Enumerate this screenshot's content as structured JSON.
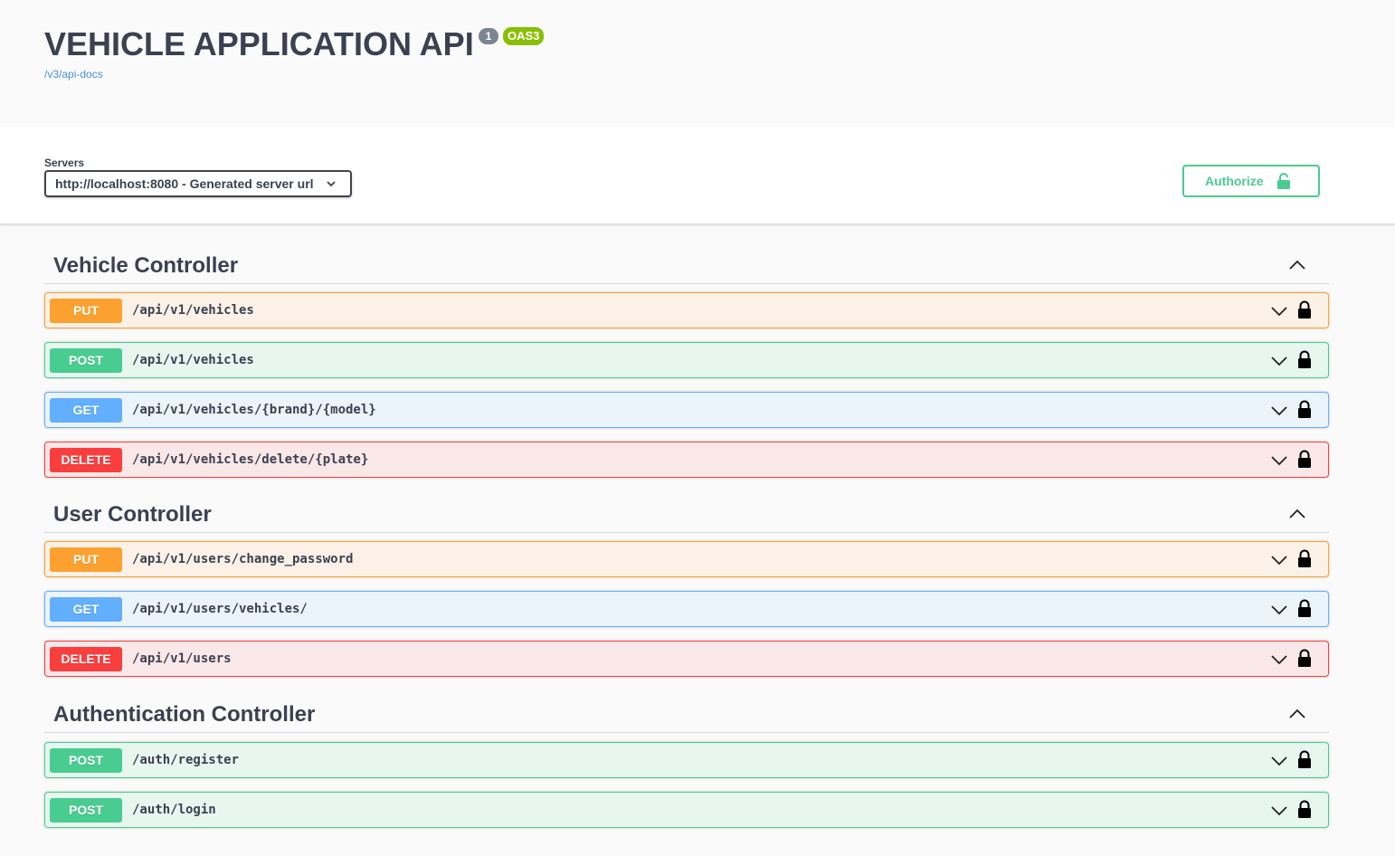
{
  "info": {
    "title": "VEHICLE APPLICATION API",
    "version": "1",
    "oas_badge": "OAS3",
    "spec_link": "/v3/api-docs"
  },
  "servers": {
    "label": "Servers",
    "selected": "http://localhost:8080 - Generated server url"
  },
  "authorize": {
    "label": "Authorize"
  },
  "colors": {
    "put": "#fca130",
    "post": "#49cc90",
    "get": "#61affe",
    "delete": "#f93e3e"
  },
  "tags": [
    {
      "name": "Vehicle Controller",
      "operations": [
        {
          "method": "PUT",
          "path": "/api/v1/vehicles"
        },
        {
          "method": "POST",
          "path": "/api/v1/vehicles"
        },
        {
          "method": "GET",
          "path": "/api/v1/vehicles/{brand}/{model}"
        },
        {
          "method": "DELETE",
          "path": "/api/v1/vehicles/delete/{plate}"
        }
      ]
    },
    {
      "name": "User Controller",
      "operations": [
        {
          "method": "PUT",
          "path": "/api/v1/users/change_password"
        },
        {
          "method": "GET",
          "path": "/api/v1/users/vehicles/"
        },
        {
          "method": "DELETE",
          "path": "/api/v1/users"
        }
      ]
    },
    {
      "name": "Authentication Controller",
      "operations": [
        {
          "method": "POST",
          "path": "/auth/register"
        },
        {
          "method": "POST",
          "path": "/auth/login"
        }
      ]
    }
  ]
}
